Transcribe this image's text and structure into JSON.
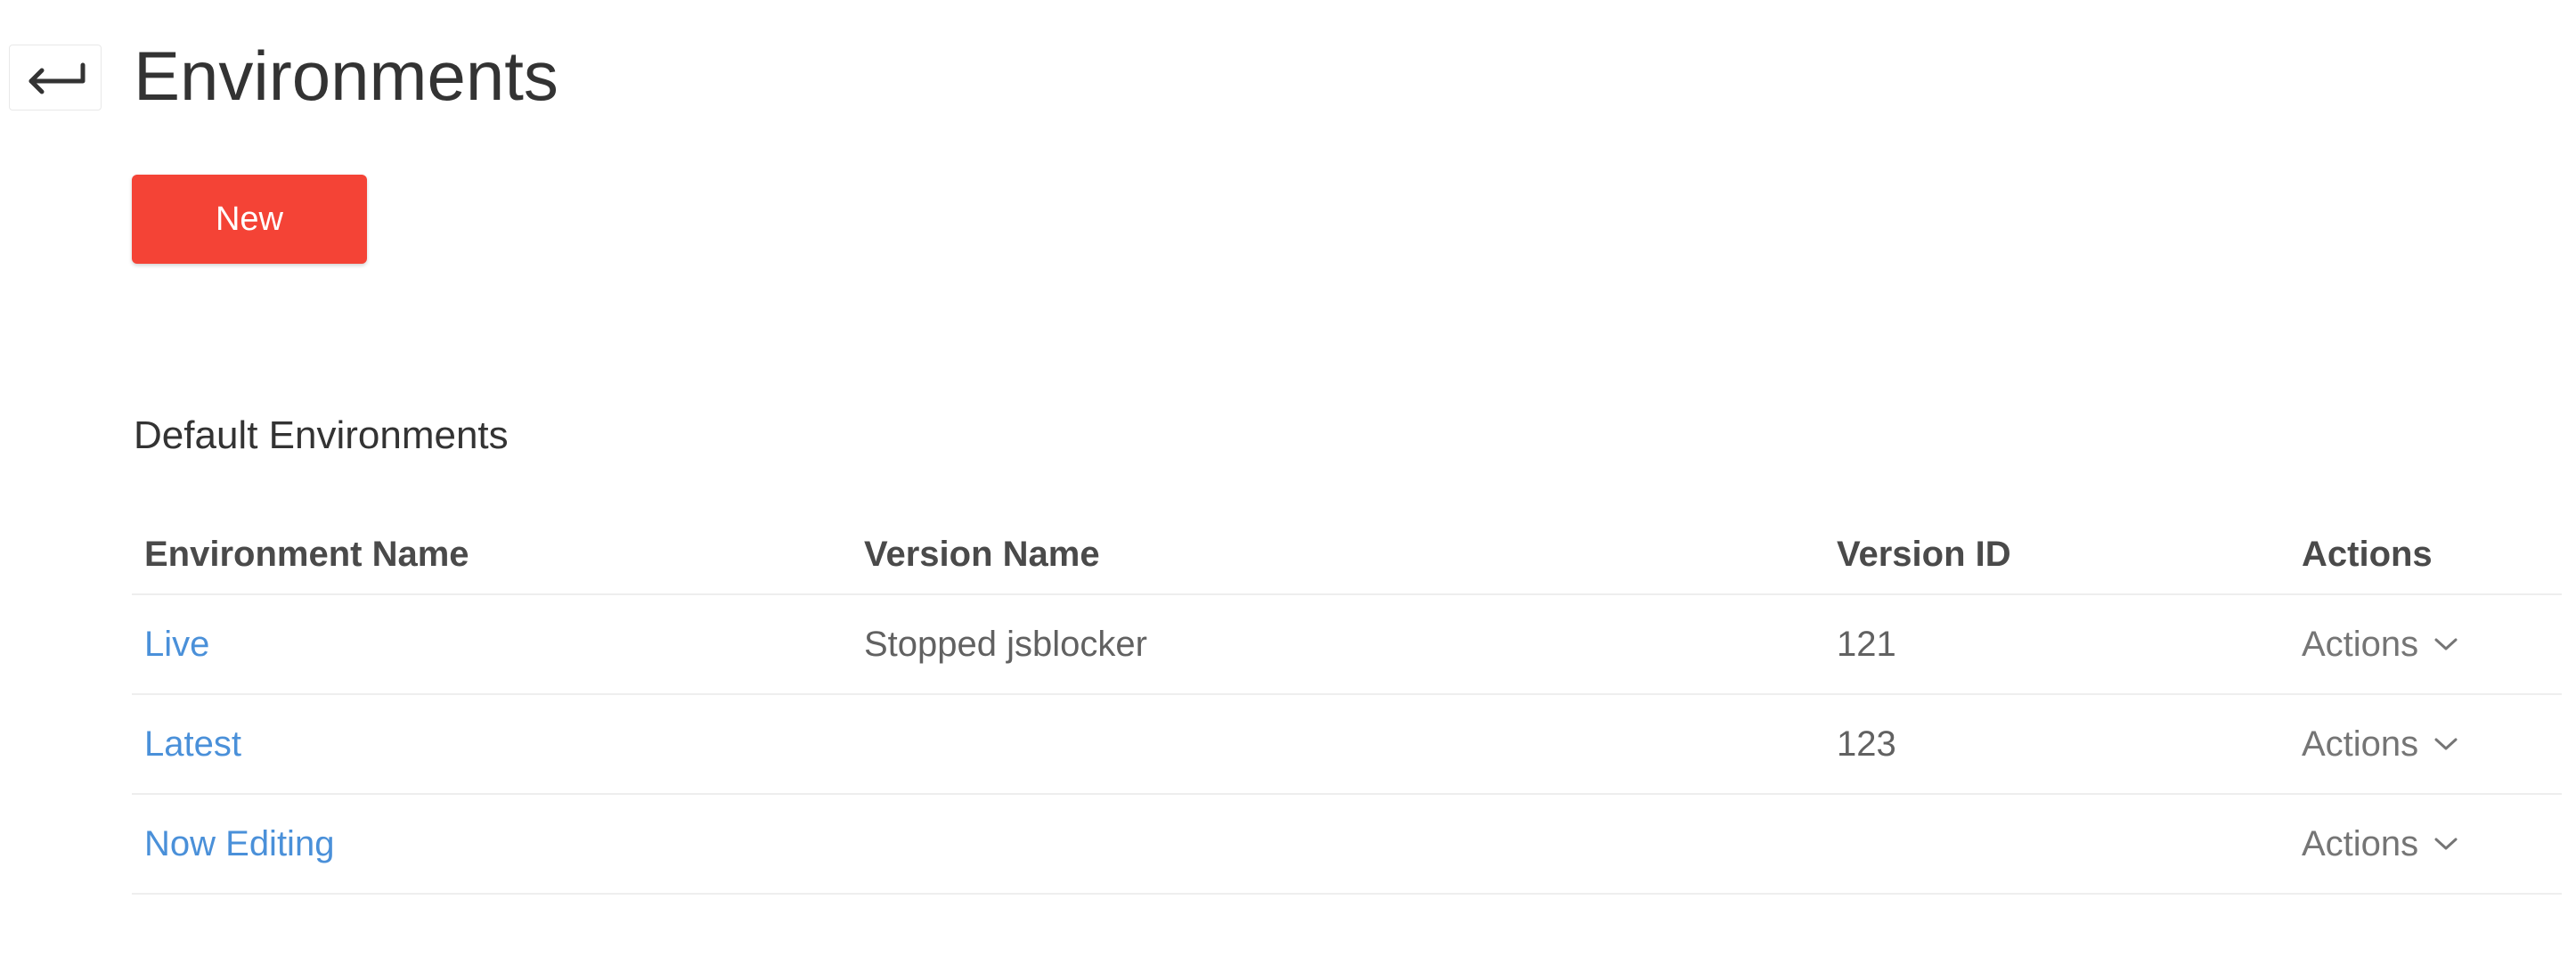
{
  "header": {
    "back_icon": "return-arrow-icon",
    "title": "Environments"
  },
  "toolbar": {
    "new_label": "New",
    "new_color": "#f44336"
  },
  "section": {
    "title": "Default Environments"
  },
  "table": {
    "columns": [
      "Environment Name",
      "Version Name",
      "Version ID",
      "Actions"
    ],
    "rows": [
      {
        "name": "Live",
        "version_name": "Stopped jsblocker",
        "version_id": "121",
        "actions": "Actions"
      },
      {
        "name": "Latest",
        "version_name": "",
        "version_id": "123",
        "actions": "Actions"
      },
      {
        "name": "Now Editing",
        "version_name": "",
        "version_id": "",
        "actions": "Actions"
      }
    ],
    "link_color": "#4a90d9",
    "actions_icon": "chevron-down-icon"
  }
}
